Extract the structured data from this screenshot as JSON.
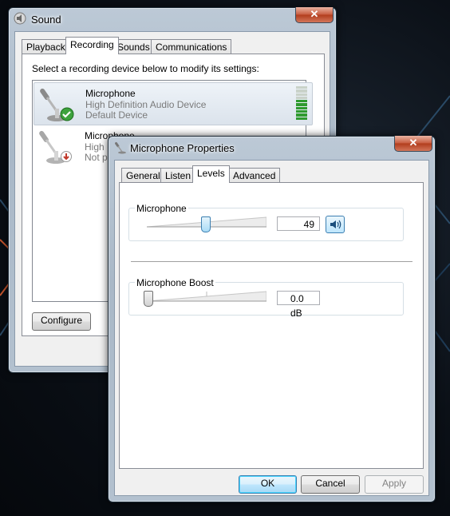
{
  "sound_window": {
    "title": "Sound",
    "close_label": "✕",
    "tabs": [
      "Playback",
      "Recording",
      "Sounds",
      "Communications"
    ],
    "active_tab": "Recording",
    "instruction": "Select a recording device below to modify its settings:",
    "devices": [
      {
        "name": "Microphone",
        "line1": "High Definition Audio Device",
        "line2": "Default Device",
        "status": "default",
        "level_bars_lit": 6,
        "level_bars_total": 10
      },
      {
        "name": "Microphone",
        "line1": "High",
        "line2": "Not p",
        "status": "unplugged"
      }
    ],
    "configure_label": "Configure"
  },
  "properties_window": {
    "title": "Microphone Properties",
    "close_label": "✕",
    "tabs": [
      "General",
      "Listen",
      "Levels",
      "Advanced"
    ],
    "active_tab": "Levels",
    "microphone": {
      "label": "Microphone",
      "value": "49",
      "level_fraction": 0.49
    },
    "boost": {
      "label": "Microphone Boost",
      "value": "0.0 dB",
      "level_fraction": 0.0
    },
    "buttons": {
      "ok": "OK",
      "cancel": "Cancel",
      "apply": "Apply"
    }
  }
}
